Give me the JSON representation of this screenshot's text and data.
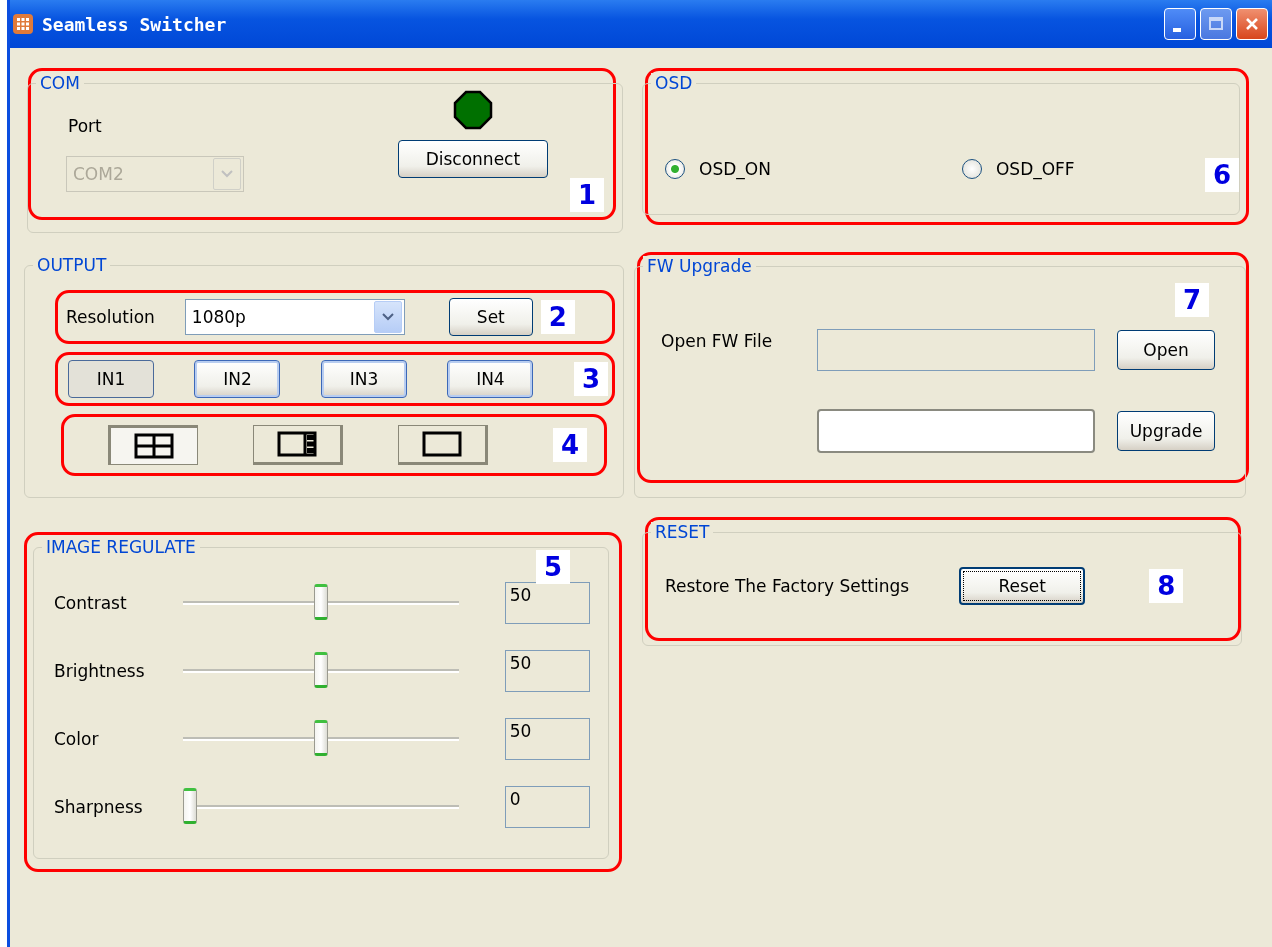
{
  "window": {
    "title": "Seamless Switcher"
  },
  "com": {
    "label": "COM",
    "callout": "1",
    "port_label": "Port",
    "port": {
      "value": "COM2",
      "disabled": true
    },
    "connected": true,
    "button": "Disconnect"
  },
  "output": {
    "label": "OUTPUT",
    "resolution": {
      "label": "Resolution",
      "value": "1080p",
      "button": "Set",
      "callout": "2"
    },
    "inputs": {
      "callout": "3",
      "buttons": [
        {
          "label": "IN1",
          "selected": true
        },
        {
          "label": "IN2",
          "selected": false
        },
        {
          "label": "IN3",
          "selected": false
        },
        {
          "label": "IN4",
          "selected": false
        }
      ]
    },
    "layouts": {
      "callout": "4",
      "items": [
        {
          "kind": "quad",
          "selected": true
        },
        {
          "kind": "side",
          "selected": false
        },
        {
          "kind": "single",
          "selected": false
        }
      ]
    }
  },
  "image_regulate": {
    "label": "IMAGE REGULATE",
    "callout": "5",
    "sliders": [
      {
        "name": "Contrast",
        "level": 0.5,
        "value": "50"
      },
      {
        "name": "Brightness",
        "level": 0.5,
        "value": "50"
      },
      {
        "name": "Color",
        "level": 0.5,
        "value": "50"
      },
      {
        "name": "Sharpness",
        "level": 0,
        "value": "0"
      }
    ]
  },
  "osd": {
    "label": "OSD",
    "callout": "6",
    "options": [
      {
        "label": "OSD_ON",
        "selected": true
      },
      {
        "label": "OSD_OFF",
        "selected": false
      }
    ]
  },
  "fw_upgrade": {
    "label": "FW Upgrade",
    "callout": "7",
    "file_label": "Open FW File",
    "open_button": "Open",
    "upgrade_button": "Upgrade"
  },
  "reset": {
    "label": "RESET",
    "callout": "8",
    "text": "Restore The Factory Settings",
    "button": "Reset"
  }
}
